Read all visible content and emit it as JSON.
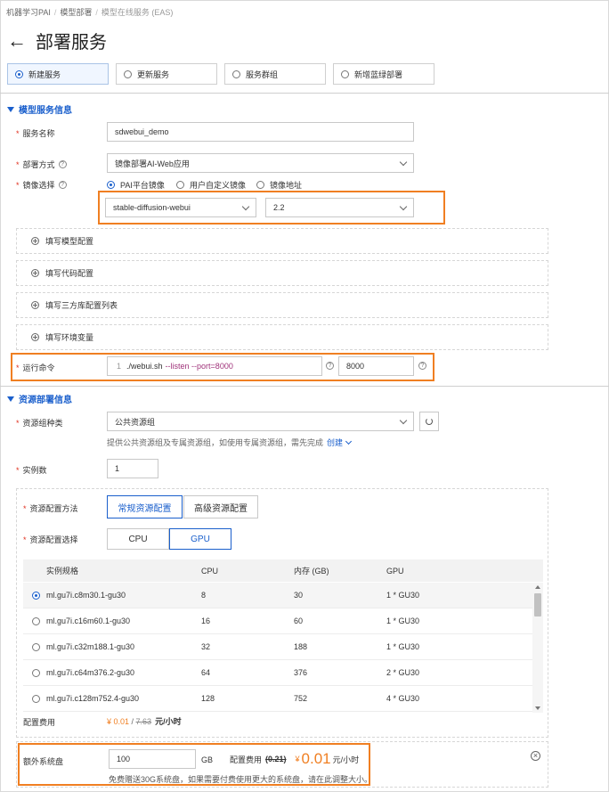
{
  "breadcrumb": [
    "机器学习PAI",
    "模型部署",
    "模型在线服务 (EAS)"
  ],
  "page_title": "部署服务",
  "mode_tabs": [
    {
      "label": "新建服务",
      "selected": true
    },
    {
      "label": "更新服务",
      "selected": false
    },
    {
      "label": "服务群组",
      "selected": false
    },
    {
      "label": "新增蓝绿部署",
      "selected": false
    }
  ],
  "model_section": {
    "title": "模型服务信息",
    "service_name_label": "服务名称",
    "service_name_value": "sdwebui_demo",
    "deploy_method_label": "部署方式",
    "deploy_method_value": "镜像部署AI-Web应用",
    "image_label": "镜像选择",
    "image_options": [
      {
        "label": "PAI平台镜像",
        "selected": true
      },
      {
        "label": "用户自定义镜像",
        "selected": false
      },
      {
        "label": "镜像地址",
        "selected": false
      }
    ],
    "image_name": "stable-diffusion-webui",
    "image_version": "2.2",
    "collapsibles": [
      "填写模型配置",
      "填写代码配置",
      "填写三方库配置列表",
      "填写环境变量"
    ],
    "run_cmd_label": "运行命令",
    "run_cmd_line": "1",
    "run_cmd_prefix": "./webui.sh",
    "run_cmd_args": "--listen --port=8000",
    "port_value": "8000"
  },
  "resource_section": {
    "title": "资源部署信息",
    "resource_group_label": "资源组种类",
    "resource_group_value": "公共资源组",
    "resource_group_help": "提供公共资源组及专属资源组，如使用专属资源组，需先完成",
    "create_link": "创建",
    "instances_label": "实例数",
    "instances_value": "1",
    "config_method_label": "资源配置方法",
    "config_methods": [
      {
        "label": "常规资源配置",
        "selected": true
      },
      {
        "label": "高级资源配置",
        "selected": false
      }
    ],
    "config_select_label": "资源配置选择",
    "config_types": [
      {
        "label": "CPU",
        "selected": false
      },
      {
        "label": "GPU",
        "selected": true
      }
    ],
    "table_headers": [
      "实例规格",
      "CPU",
      "内存 (GB)",
      "GPU"
    ],
    "table_rows": [
      {
        "spec": "ml.gu7i.c8m30.1-gu30",
        "cpu": "8",
        "mem": "30",
        "gpu": "1 * GU30",
        "selected": true
      },
      {
        "spec": "ml.gu7i.c16m60.1-gu30",
        "cpu": "16",
        "mem": "60",
        "gpu": "1 * GU30",
        "selected": false
      },
      {
        "spec": "ml.gu7i.c32m188.1-gu30",
        "cpu": "32",
        "mem": "188",
        "gpu": "1 * GU30",
        "selected": false
      },
      {
        "spec": "ml.gu7i.c64m376.2-gu30",
        "cpu": "64",
        "mem": "376",
        "gpu": "2 * GU30",
        "selected": false
      },
      {
        "spec": "ml.gu7i.c128m752.4-gu30",
        "cpu": "128",
        "mem": "752",
        "gpu": "4 * GU30",
        "selected": false
      }
    ],
    "cost_label": "配置费用",
    "cost_current": "¥ 0.01",
    "cost_sep": " / ",
    "cost_original": "7.63",
    "cost_unit": "元/小时",
    "disk_label": "额外系统盘",
    "disk_value": "100",
    "disk_unit": "GB",
    "disk_cost_label": "配置费用",
    "disk_cost_original": "(0.21)",
    "disk_cost_currency": "¥",
    "disk_cost_current": "0.01",
    "disk_cost_unit": "元/小时",
    "disk_help": "免费赠送30G系统盘，如果需要付费使用更大的系统盘，请在此调整大小。"
  },
  "colors": {
    "accent": "#1a5fcc",
    "highlight": "#f07f22",
    "price": "#f07f22",
    "required": "#e0301e"
  }
}
